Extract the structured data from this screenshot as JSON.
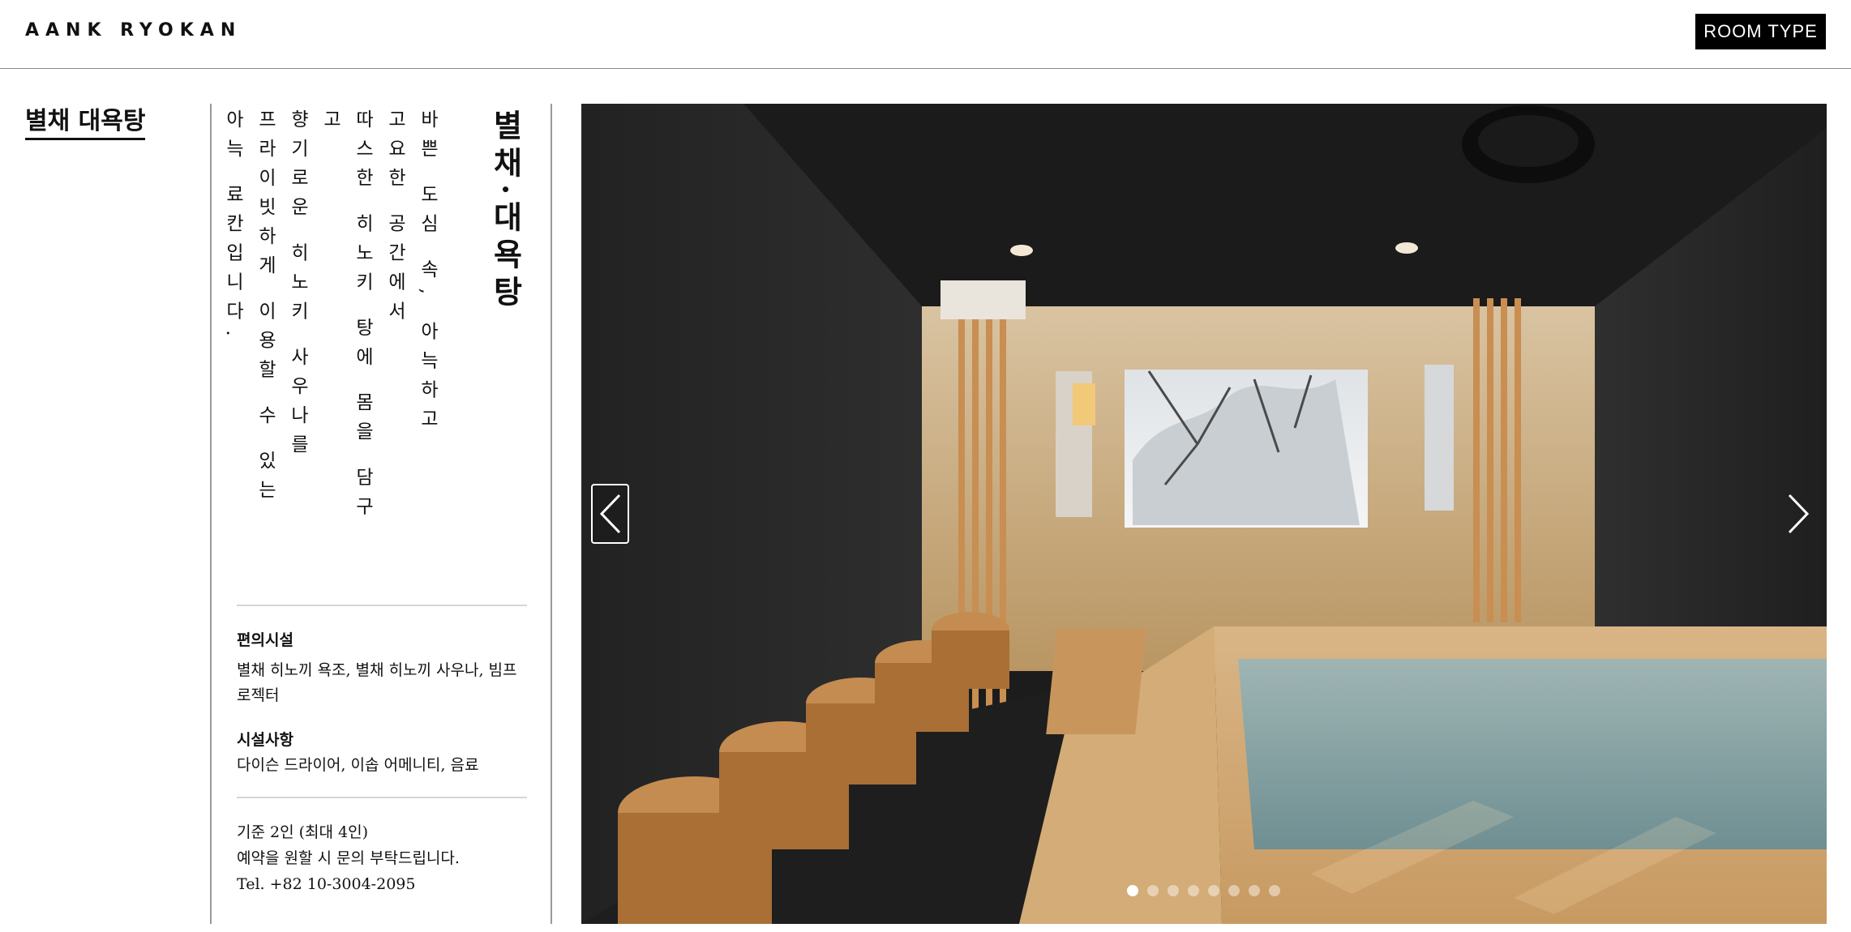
{
  "header": {
    "brand": "AANK RYOKAN",
    "room_type_label": "ROOM TYPE"
  },
  "page_title": "별채 대욕탕",
  "vertical": {
    "title": "별채·대욕탕",
    "lines": [
      "바쁜 도심 속, 아늑하고",
      "고요한 공간에서",
      "따스한 히노키 탕에 몸을 담구고",
      "향기로운 히노키 사우나를",
      "프라이빗하게 이용할 수 있는",
      "아늑 료칸입니다."
    ]
  },
  "amenities": {
    "label": "편의시설",
    "value": "별채 히노끼 욕조, 별채 히노끼 사우나, 빔프로젝터"
  },
  "facilities": {
    "label": "시설사항",
    "value": "다이슨 드라이어, 이솝 어메니티, 음료"
  },
  "contact": {
    "capacity": "기준 2인 (최대 4인)",
    "note": "예약을 원할 시 문의 부탁드립니다.",
    "phone": "Tel. +82 10-3004-2095"
  },
  "carousel": {
    "slide_count": 8,
    "active_index": 0,
    "icons": {
      "prev": "chevron-left-icon",
      "next": "chevron-right-icon"
    }
  }
}
